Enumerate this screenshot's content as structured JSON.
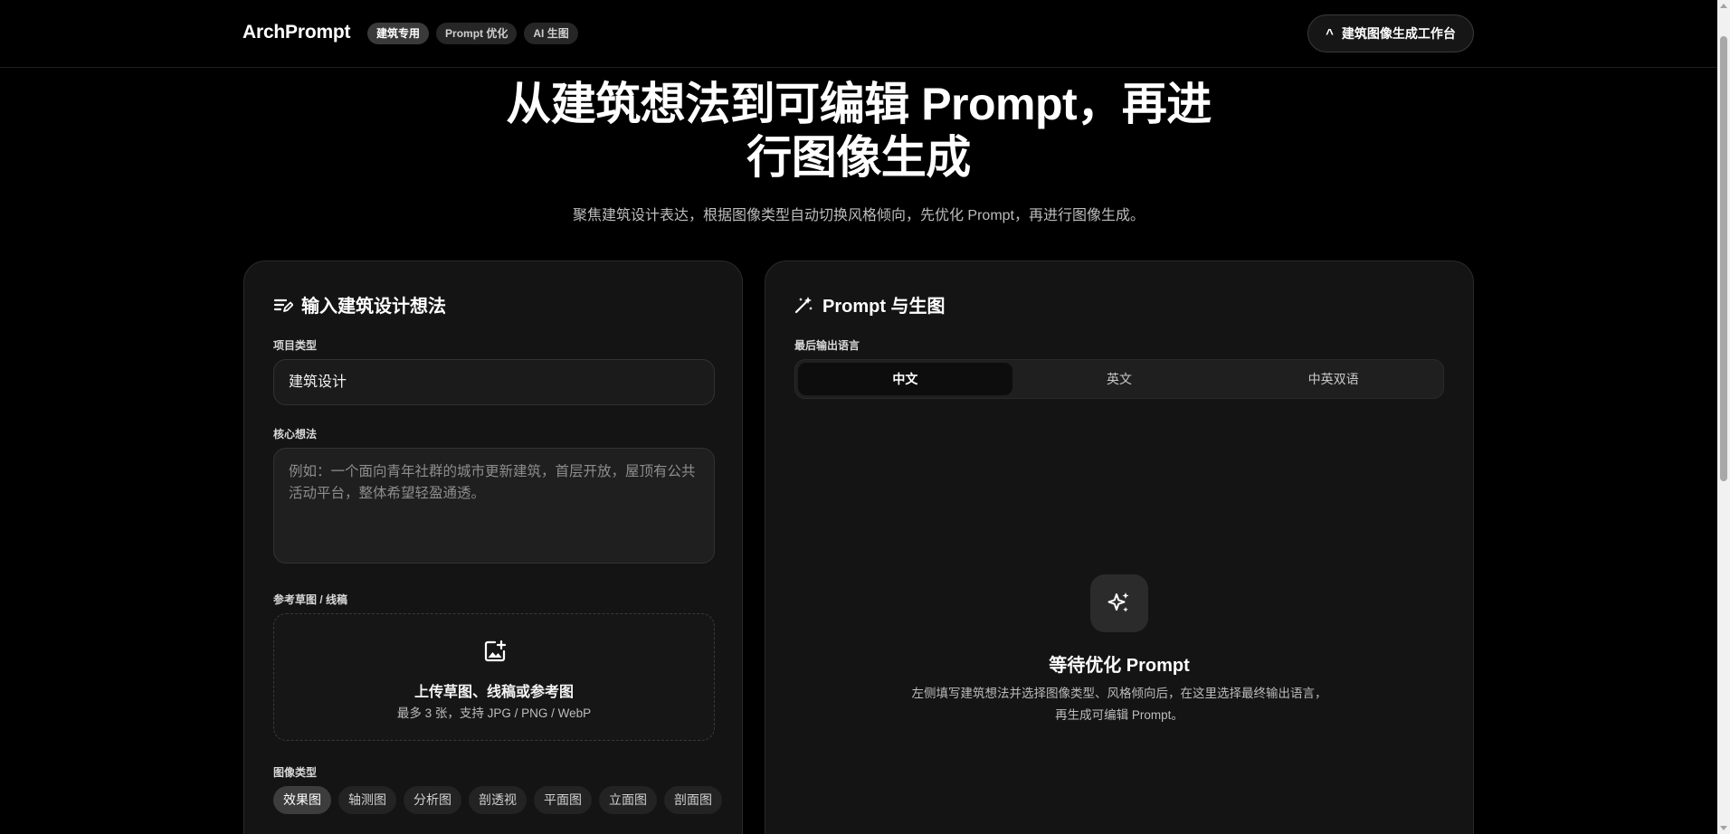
{
  "header": {
    "brand": "ArchPrompt",
    "chips": [
      "建筑专用",
      "Prompt 优化",
      "AI 生图"
    ],
    "workbench_icon": "^",
    "workbench_label": "建筑图像生成工作台"
  },
  "hero": {
    "title_line1": "从建筑想法到可编辑 Prompt，再进",
    "title_line2": "行图像生成",
    "subtitle": "聚焦建筑设计表达，根据图像类型自动切换风格倾向，先优化 Prompt，再进行图像生成。"
  },
  "left_panel": {
    "title": "输入建筑设计想法",
    "project_type_label": "项目类型",
    "project_type_value": "建筑设计",
    "core_idea_label": "核心想法",
    "core_idea_placeholder": "例如：一个面向青年社群的城市更新建筑，首层开放，屋顶有公共活动平台，整体希望轻盈通透。",
    "reference_label": "参考草图 / 线稿",
    "upload_title": "上传草图、线稿或参考图",
    "upload_hint": "最多 3 张，支持 JPG / PNG / WebP",
    "image_type_label": "图像类型",
    "image_types": [
      "效果图",
      "轴测图",
      "分析图",
      "剖透视",
      "平面图",
      "立面图",
      "剖面图"
    ]
  },
  "right_panel": {
    "title": "Prompt 与生图",
    "output_language_label": "最后输出语言",
    "languages": [
      "中文",
      "英文",
      "中英双语"
    ],
    "empty_title": "等待优化 Prompt",
    "empty_desc": "左侧填写建筑想法并选择图像类型、风格倾向后，在这里选择最终输出语言，再生成可编辑 Prompt。"
  },
  "icons": {
    "left_title_icon": "edit-list-icon",
    "right_title_icon": "wand-sparkle-icon",
    "upload_icon": "image-add-icon",
    "empty_icon": "sparkles-icon"
  }
}
